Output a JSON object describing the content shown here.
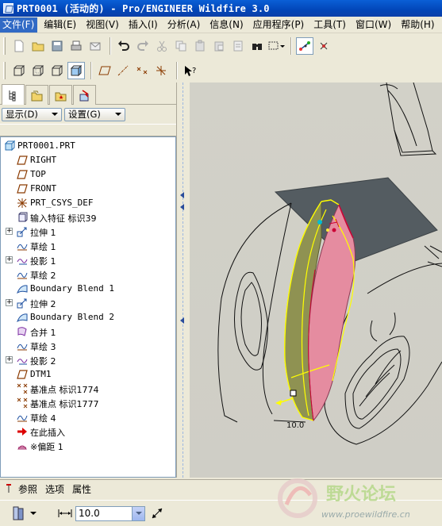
{
  "window": {
    "title": "PRT0001 (活动的) - Pro/ENGINEER Wildfire 3.0"
  },
  "menu": [
    {
      "label": "文件(F)"
    },
    {
      "label": "编辑(E)"
    },
    {
      "label": "视图(V)"
    },
    {
      "label": "插入(I)"
    },
    {
      "label": "分析(A)"
    },
    {
      "label": "信息(N)"
    },
    {
      "label": "应用程序(P)"
    },
    {
      "label": "工具(T)"
    },
    {
      "label": "窗口(W)"
    },
    {
      "label": "帮助(H)"
    }
  ],
  "nav": {
    "show_label": "显示(D)",
    "settings_label": "设置(G)"
  },
  "tree": [
    {
      "label": "PRT0001.PRT",
      "icon": "part-icon",
      "expand": false,
      "indent": 0
    },
    {
      "label": "RIGHT",
      "icon": "datum-plane-icon",
      "expand": false,
      "indent": 1
    },
    {
      "label": "TOP",
      "icon": "datum-plane-icon",
      "expand": false,
      "indent": 1
    },
    {
      "label": "FRONT",
      "icon": "datum-plane-icon",
      "expand": false,
      "indent": 1
    },
    {
      "label": "PRT_CSYS_DEF",
      "icon": "csys-icon",
      "expand": false,
      "indent": 1
    },
    {
      "label": "输入特征 标识39",
      "icon": "import-feature-icon",
      "expand": false,
      "indent": 1
    },
    {
      "label": "拉伸 1",
      "icon": "extrude-icon",
      "expand": true,
      "indent": 1
    },
    {
      "label": "草绘 1",
      "icon": "sketch-icon",
      "expand": false,
      "indent": 1
    },
    {
      "label": "投影 1",
      "icon": "project-icon",
      "expand": true,
      "indent": 1
    },
    {
      "label": "草绘 2",
      "icon": "sketch-icon",
      "expand": false,
      "indent": 1
    },
    {
      "label": "Boundary Blend 1",
      "icon": "boundary-blend-icon",
      "expand": false,
      "indent": 1
    },
    {
      "label": "拉伸 2",
      "icon": "extrude-icon",
      "expand": true,
      "indent": 1
    },
    {
      "label": "Boundary Blend 2",
      "icon": "boundary-blend-icon",
      "expand": false,
      "indent": 1
    },
    {
      "label": "合并 1",
      "icon": "merge-icon",
      "expand": false,
      "indent": 1
    },
    {
      "label": "草绘 3",
      "icon": "sketch-icon",
      "expand": false,
      "indent": 1
    },
    {
      "label": "投影 2",
      "icon": "project-icon",
      "expand": true,
      "indent": 1
    },
    {
      "label": "DTM1",
      "icon": "datum-plane-icon",
      "expand": false,
      "indent": 1
    },
    {
      "label": "基准点 标识1774",
      "icon": "datum-point-icon",
      "expand": false,
      "indent": 1
    },
    {
      "label": "基准点 标识1777",
      "icon": "datum-point-icon",
      "expand": false,
      "indent": 1
    },
    {
      "label": "草绘 4",
      "icon": "sketch-icon",
      "expand": false,
      "indent": 1
    },
    {
      "label": "在此插入",
      "icon": "insert-here-arrow-icon",
      "expand": false,
      "indent": 1
    },
    {
      "label": "※偏距 1",
      "icon": "offset-icon",
      "expand": false,
      "indent": 1
    }
  ],
  "viewport": {
    "dimension_label": "10.0"
  },
  "dashboard": {
    "tabs": [
      {
        "label": "参照"
      },
      {
        "label": "选项"
      },
      {
        "label": "属性"
      }
    ],
    "offset_value": "10.0"
  },
  "watermark": {
    "text": "野火论坛",
    "url": "www.proewildfire.cn"
  },
  "colors": {
    "title_bar": "#0a5fd6",
    "tree_background": "#ffffff",
    "surface_pink": "#e58ca0",
    "surface_highlight": "#ffff00",
    "viewport_background": "#d1d0c8"
  }
}
